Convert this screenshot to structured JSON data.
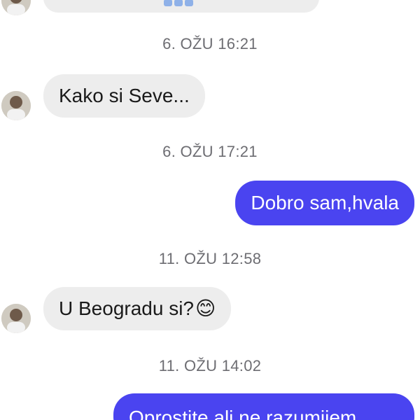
{
  "conversation": {
    "messages": [
      {
        "kind": "timestamp",
        "text": "6. OŽU 16:21"
      },
      {
        "kind": "incoming",
        "text": "Kako si Seve..."
      },
      {
        "kind": "timestamp",
        "text": "6. OŽU 17:21"
      },
      {
        "kind": "outgoing",
        "text": "Dobro sam,hvala"
      },
      {
        "kind": "timestamp",
        "text": "11. OŽU 12:58"
      },
      {
        "kind": "incoming",
        "text": "U Beogradu si?",
        "emoji": "😊"
      },
      {
        "kind": "timestamp",
        "text": "11. OŽU 14:02"
      },
      {
        "kind": "outgoing",
        "text": "Oprostite ali ne razumijem"
      }
    ]
  },
  "colors": {
    "outgoing_bubble": "#4a44f0",
    "incoming_bubble": "#ededed",
    "timestamp_text": "#6d6d72"
  },
  "icons": {
    "avatar": "avatar-icon",
    "emoji": "smiling-face-icon"
  }
}
